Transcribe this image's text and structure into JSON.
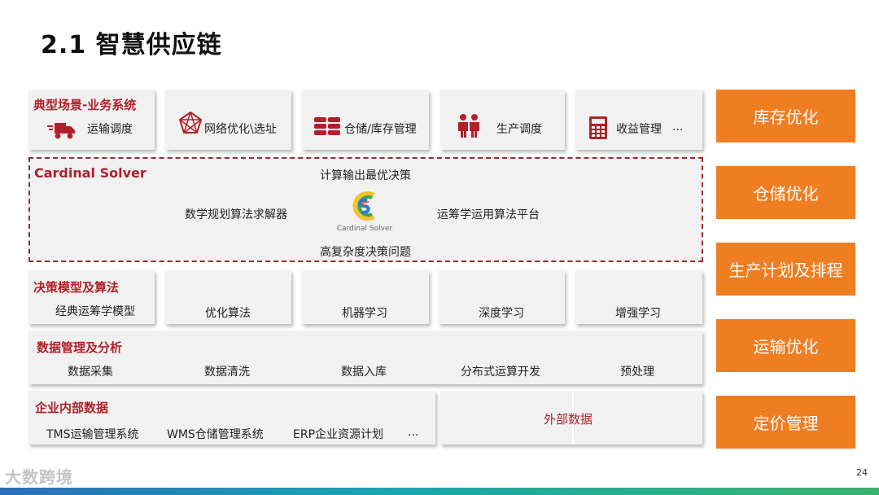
{
  "title": "2.1 智慧供应链",
  "scenario": {
    "title": "典型场景-业务系统",
    "items": [
      {
        "label": "运输调度",
        "icon": "truck-icon"
      },
      {
        "label": "网络优化\\选址",
        "icon": "network-icon"
      },
      {
        "label": "仓储/库存管理",
        "icon": "database-icon"
      },
      {
        "label": "生产调度",
        "icon": "workers-icon"
      },
      {
        "label": "收益管理",
        "icon": "calculator-icon"
      }
    ],
    "ellipsis": "..."
  },
  "solver": {
    "title": "Cardinal Solver",
    "top": "计算输出最优决策",
    "left": "数学规划算法求解器",
    "right": "运筹学运用算法平台",
    "bottom": "高复杂度决策问题",
    "logo_text": "Cardinal Solver"
  },
  "models": {
    "title": "决策模型及算法",
    "items": [
      "经典运筹学模型",
      "优化算法",
      "机器学习",
      "深度学习",
      "增强学习"
    ]
  },
  "data_mgmt": {
    "title": "数据管理及分析",
    "items": [
      "数据采集",
      "数据清洗",
      "数据入库",
      "分布式运算开发",
      "预处理"
    ]
  },
  "internal": {
    "title": "企业内部数据",
    "items": [
      "TMS运输管理系统",
      "WMS仓储管理系统",
      "ERP企业资源计划",
      "..."
    ]
  },
  "external": {
    "title": "外部数据"
  },
  "applications": [
    "库存优化",
    "仓储优化",
    "生产计划及排程",
    "运输优化",
    "定价管理"
  ],
  "page_number": "24",
  "watermark": "大数跨境",
  "colors": {
    "accent": "#ef7d22",
    "section_title": "#b0202a",
    "dashed_border": "#9a2a2a"
  }
}
